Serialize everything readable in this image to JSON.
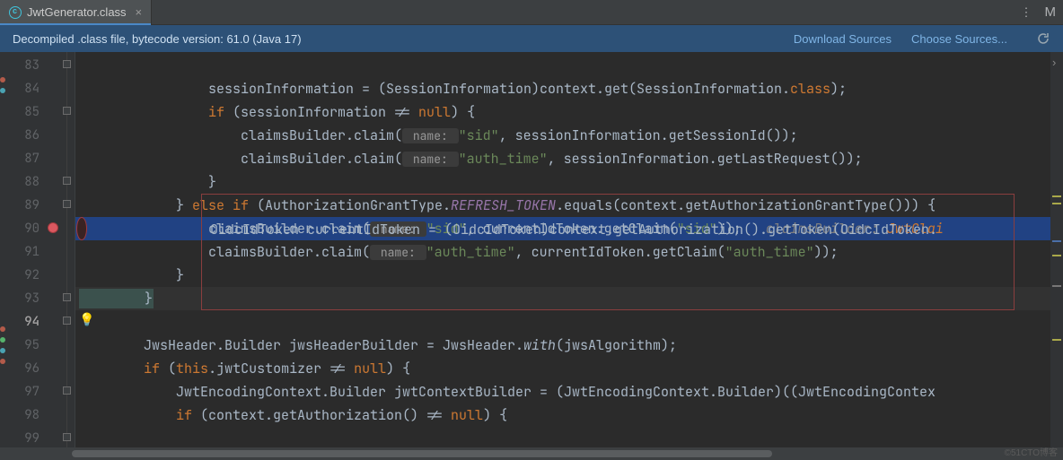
{
  "tab": {
    "filename": "JwtGenerator.class",
    "right_letter": "M"
  },
  "banner": {
    "text": "Decompiled .class file, bytecode version: 61.0 (Java 17)",
    "download": "Download Sources",
    "choose": "Choose Sources..."
  },
  "gutter": {
    "start": 83,
    "end": 99,
    "breakpoint_line": 90,
    "selected_line": 91,
    "caret_line": 94,
    "bulb_line": 94,
    "fold_lines": [
      83,
      85,
      88,
      89,
      93,
      94,
      97,
      99
    ]
  },
  "code": {
    "l83": "",
    "l84": {
      "a": "                sessionInformation = (SessionInformation)context.get(SessionInformation.",
      "b": "class",
      "c": ");"
    },
    "l85": {
      "a": "                ",
      "b": "if ",
      "c": "(sessionInformation != ",
      "d": "null",
      "e": ") {"
    },
    "l86": {
      "a": "                    claimsBuilder.claim(",
      "hint": " name: ",
      "s": "\"sid\"",
      "b": ", sessionInformation.getSessionId());"
    },
    "l87": {
      "a": "                    claimsBuilder.claim(",
      "hint": " name: ",
      "s": "\"auth_time\"",
      "b": ", sessionInformation.getLastRequest());"
    },
    "l88": "                }",
    "l89": {
      "a": "            } ",
      "b": "else if ",
      "c": "(AuthorizationGrantType.",
      "d": "REFRESH_TOKEN",
      "e": ".equals(context.getAuthorizationGrantType())) {"
    },
    "l90": "                OidcIdToken currentIdToken = (OidcIdToken)context.getAuthorization().getToken(OidcIdToken.",
    "l91": {
      "a": "                claimsBuilder.claim(",
      "hint": " name: ",
      "s": "\"sid\"",
      "b": ", currentIdToken.getClaim(",
      "s2": "\"sid\"",
      "c": "));   ",
      "cm": "claimsBuilder:",
      "cmt": " JwtClai"
    },
    "l92": {
      "a": "                claimsBuilder.claim(",
      "hint": " name: ",
      "s": "\"auth_time\"",
      "b": ", currentIdToken.getClaim(",
      "s2": "\"auth_time\"",
      "c": "));"
    },
    "l93": "            }",
    "l94": "        }",
    "l95": "",
    "l96": {
      "a": "        JwsHeader.Builder jwsHeaderBuilder = JwsHeader.",
      "m": "with",
      "b": "(jwsAlgorithm);"
    },
    "l97": {
      "a": "        ",
      "b": "if ",
      "c": "(",
      "d": "this",
      "e": ".jwtCustomizer != ",
      "f": "null",
      "g": ") {"
    },
    "l98": "            JwtEncodingContext.Builder jwtContextBuilder = (JwtEncodingContext.Builder)((JwtEncodingContex",
    "l99": {
      "a": "            ",
      "b": "if ",
      "c": "(context.getAuthorization() != ",
      "d": "null",
      "e": ") {"
    }
  },
  "watermark": "©51CTO博客"
}
